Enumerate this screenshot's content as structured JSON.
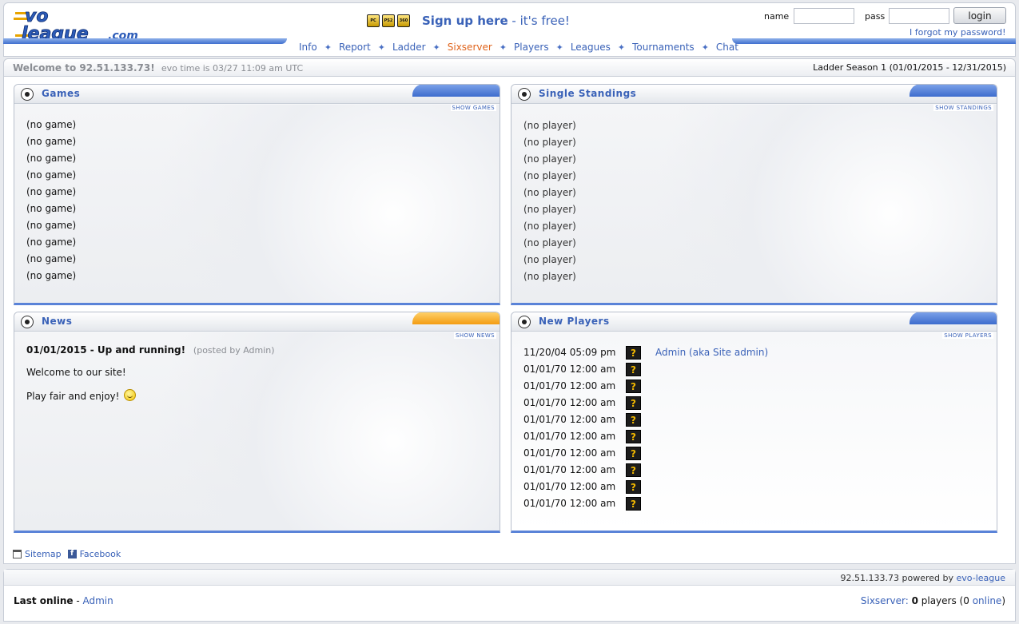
{
  "header": {
    "logo_text": "evo league.com",
    "platform_badges": [
      "PC",
      "PS2",
      "360"
    ],
    "signup_strong": "Sign up here",
    "signup_rest": " - it's free!",
    "name_label": "name",
    "pass_label": "pass",
    "name_value": "",
    "pass_value": "",
    "login_button": "login",
    "forgot_link": "I forgot my password!"
  },
  "nav": {
    "items": [
      {
        "label": "Info",
        "active": false
      },
      {
        "label": "Report",
        "active": false
      },
      {
        "label": "Ladder",
        "active": false
      },
      {
        "label": "Sixserver",
        "active": true
      },
      {
        "label": "Players",
        "active": false
      },
      {
        "label": "Leagues",
        "active": false
      },
      {
        "label": "Tournaments",
        "active": false
      },
      {
        "label": "Chat",
        "active": false
      }
    ],
    "separator": "✦"
  },
  "welcome": {
    "text": "Welcome to 92.51.133.73!",
    "evo_time": "evo time is 03/27 11:09 am UTC",
    "season": "Ladder Season 1 (01/01/2015 - 12/31/2015)"
  },
  "games_panel": {
    "title": "Games",
    "link": "show games",
    "rows": [
      "(no game)",
      "(no game)",
      "(no game)",
      "(no game)",
      "(no game)",
      "(no game)",
      "(no game)",
      "(no game)",
      "(no game)",
      "(no game)"
    ]
  },
  "standings_panel": {
    "title": "Single Standings",
    "link": "show standings",
    "rows": [
      "(no player)",
      "(no player)",
      "(no player)",
      "(no player)",
      "(no player)",
      "(no player)",
      "(no player)",
      "(no player)",
      "(no player)",
      "(no player)"
    ]
  },
  "news_panel": {
    "title": "News",
    "link": "show news",
    "item_title": "01/01/2015 - Up and running!",
    "item_posted": "(posted by Admin)",
    "item_p1": "Welcome to our site!",
    "item_p2": "Play fair and enjoy!"
  },
  "new_players_panel": {
    "title": "New Players",
    "link": "show players",
    "rows": [
      {
        "date": "11/20/04 05:09 pm",
        "flag": "?",
        "name": "Admin (aka Site admin)"
      },
      {
        "date": "01/01/70 12:00 am",
        "flag": "?",
        "name": ""
      },
      {
        "date": "01/01/70 12:00 am",
        "flag": "?",
        "name": ""
      },
      {
        "date": "01/01/70 12:00 am",
        "flag": "?",
        "name": ""
      },
      {
        "date": "01/01/70 12:00 am",
        "flag": "?",
        "name": ""
      },
      {
        "date": "01/01/70 12:00 am",
        "flag": "?",
        "name": ""
      },
      {
        "date": "01/01/70 12:00 am",
        "flag": "?",
        "name": ""
      },
      {
        "date": "01/01/70 12:00 am",
        "flag": "?",
        "name": ""
      },
      {
        "date": "01/01/70 12:00 am",
        "flag": "?",
        "name": ""
      },
      {
        "date": "01/01/70 12:00 am",
        "flag": "?",
        "name": ""
      }
    ]
  },
  "sitelinks": {
    "sitemap": "Sitemap",
    "facebook": "Facebook",
    "facebook_glyph": "f"
  },
  "footer": {
    "powered_ip": "92.51.133.73",
    "powered_mid": " powered by ",
    "powered_link": "evo-league",
    "last_online_label": "Last online",
    "last_online_sep": " - ",
    "last_online_user": "Admin",
    "sixserver_label": "Sixserver:",
    "sixserver_count": "0",
    "sixserver_players": " players (",
    "sixserver_online_count": "0",
    "sixserver_online_link": "online",
    "sixserver_close": ")"
  },
  "colors": {
    "link": "#3a62b8",
    "active_nav": "#e0641c",
    "panel_accent_blue": "#3d6ccd",
    "panel_accent_orange": "#f39c12"
  }
}
